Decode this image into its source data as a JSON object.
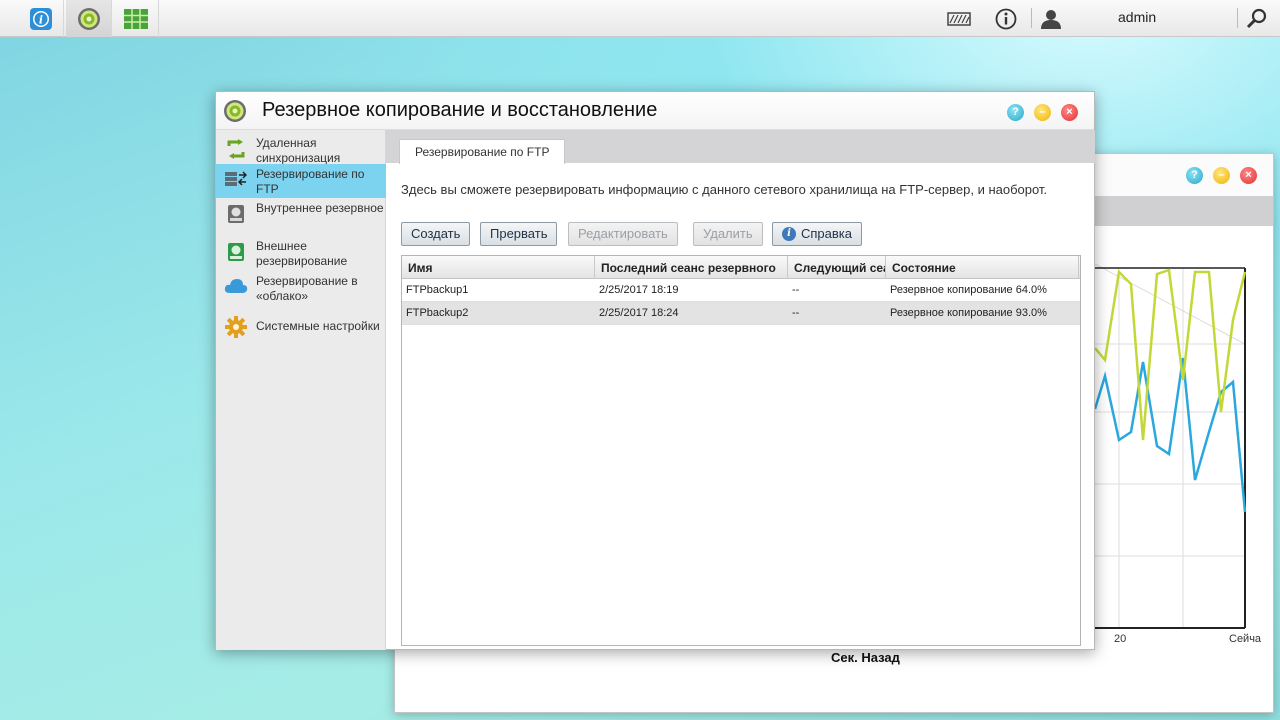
{
  "taskbar": {
    "apps": [
      {
        "name": "info-app"
      },
      {
        "name": "backup-app"
      },
      {
        "name": "grid-app"
      }
    ],
    "user": "admin"
  },
  "bg_window": {
    "xlabel": "Сек. Назад",
    "tick_20": "20",
    "tick_now": "Сейча"
  },
  "window": {
    "title": "Резервное копирование и восстановление"
  },
  "sidebar": {
    "items": [
      {
        "label": "Удаленная синхронизация",
        "icon": "sync-icon"
      },
      {
        "label": "Резервирование по FTP",
        "icon": "ftp-icon"
      },
      {
        "label": "Внутреннее резервное",
        "icon": "internal-backup-icon"
      },
      {
        "label": "Внешнее резервирование",
        "icon": "external-backup-icon"
      },
      {
        "label": "Резервирование в «облако»",
        "icon": "cloud-icon"
      },
      {
        "label": "Системные настройки",
        "icon": "gear-icon"
      }
    ]
  },
  "tab": {
    "label": "Резервирование по FTP"
  },
  "description": "Здесь вы сможете резервировать информацию с данного сетевого хранилища на FTP-сервер, и наоборот.",
  "toolbar": {
    "create": "Создать",
    "abort": "Прервать",
    "edit": "Редактировать",
    "delete": "Удалить",
    "help": "Справка"
  },
  "table": {
    "headers": [
      "Имя",
      "Последний сеанс резервного",
      "Следующий сеанс",
      "Состояние"
    ],
    "rows": [
      {
        "name": "FTPbackup1",
        "last": "2/25/2017 18:19",
        "next": "--",
        "status": "Резервное копирование 64.0%"
      },
      {
        "name": "FTPbackup2",
        "last": "2/25/2017 18:24",
        "next": "--",
        "status": "Резервное копирование 93.0%"
      }
    ]
  }
}
